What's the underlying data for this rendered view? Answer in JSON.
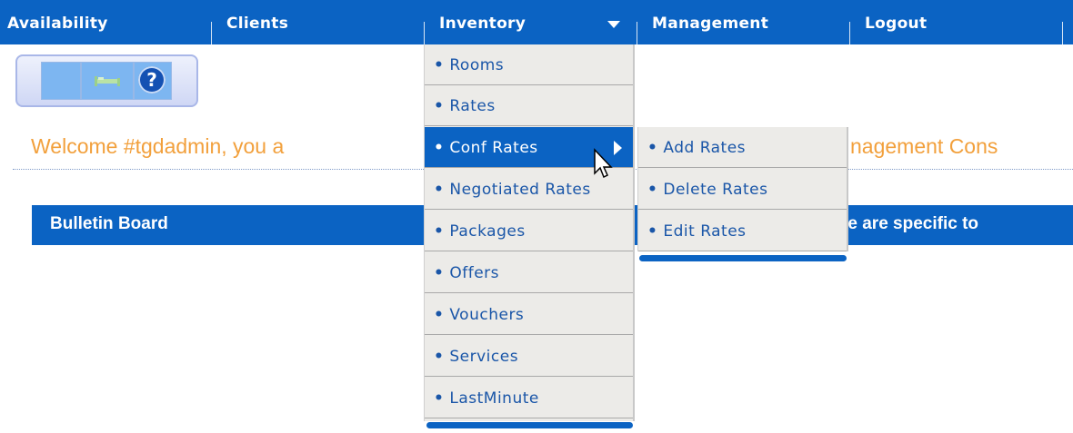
{
  "nav": {
    "items": [
      "Availability",
      "Clients",
      "Inventory",
      "Management",
      "Logout"
    ]
  },
  "toolbar": {
    "icons": [
      "blank-icon",
      "bed-icon",
      "help-icon"
    ],
    "help_glyph": "?"
  },
  "welcome": {
    "left_text": "Welcome #tgdadmin, you a",
    "right_text": "nagement Cons"
  },
  "bulletin": {
    "title": "Bulletin Board",
    "right_text": "re are specific to"
  },
  "inventory_menu": {
    "items": [
      "Rooms",
      "Rates",
      "Conf Rates",
      "Negotiated Rates",
      "Packages",
      "Offers",
      "Vouchers",
      "Services",
      "LastMinute"
    ],
    "active": "Conf Rates"
  },
  "conf_rates_submenu": {
    "items": [
      "Add Rates",
      "Delete Rates",
      "Edit Rates"
    ]
  },
  "colors": {
    "nav_blue": "#0b63c3",
    "menu_bg": "#ecebe8",
    "menu_text": "#1a56a8",
    "welcome_orange": "#f2a03c"
  }
}
